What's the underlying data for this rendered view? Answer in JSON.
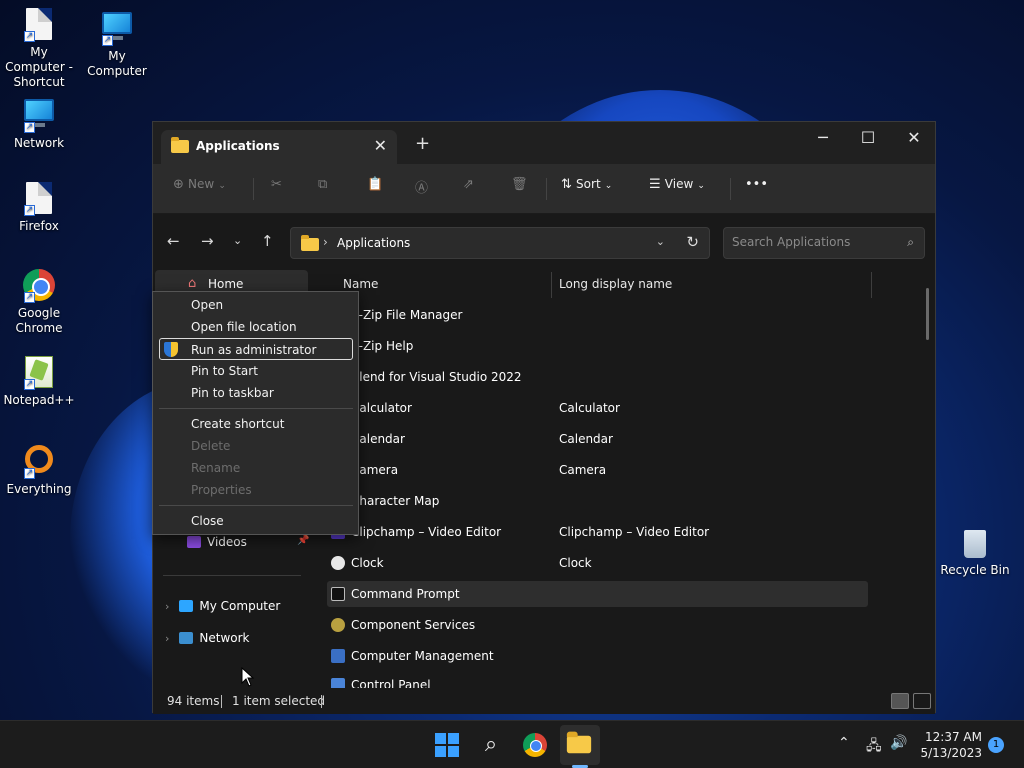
{
  "desktop": {
    "icons": [
      {
        "label": "My Computer - Shortcut"
      },
      {
        "label": "My Computer"
      },
      {
        "label": "Network"
      },
      {
        "label": "Firefox"
      },
      {
        "label": "Google Chrome"
      },
      {
        "label": "Notepad++"
      },
      {
        "label": "Everything"
      }
    ],
    "recycle_bin": "Recycle Bin"
  },
  "window": {
    "tab_title": "Applications",
    "toolbar": {
      "new_label": "New",
      "sort_label": "Sort",
      "view_label": "View"
    },
    "address": {
      "path": "Applications",
      "search_placeholder": "Search Applications"
    },
    "nav": {
      "home": "Home",
      "videos": "Videos",
      "my_computer": "My Computer",
      "network": "Network"
    },
    "columns": {
      "name": "Name",
      "long_display_name": "Long display name"
    },
    "rows": [
      {
        "name": "7-Zip File Manager",
        "long": ""
      },
      {
        "name": "7-Zip Help",
        "long": ""
      },
      {
        "name": "Blend for Visual Studio 2022",
        "long": ""
      },
      {
        "name": "Calculator",
        "long": "Calculator"
      },
      {
        "name": "Calendar",
        "long": "Calendar"
      },
      {
        "name": "Camera",
        "long": "Camera"
      },
      {
        "name": "Character Map",
        "long": ""
      },
      {
        "name": "Clipchamp – Video Editor",
        "long": "Clipchamp – Video Editor"
      },
      {
        "name": "Clock",
        "long": "Clock"
      },
      {
        "name": "Command Prompt",
        "long": ""
      },
      {
        "name": "Component Services",
        "long": ""
      },
      {
        "name": "Computer Management",
        "long": ""
      },
      {
        "name": "Control Panel",
        "long": ""
      }
    ],
    "status": {
      "items": "94 items",
      "selected": "1 item selected"
    }
  },
  "context_menu": {
    "items": [
      {
        "label": "Open",
        "enabled": true
      },
      {
        "label": "Open file location",
        "enabled": true
      },
      {
        "label": "Run as administrator",
        "enabled": true
      },
      {
        "label": "Pin to Start",
        "enabled": true
      },
      {
        "label": "Pin to taskbar",
        "enabled": true
      },
      {
        "label": "Create shortcut",
        "enabled": true
      },
      {
        "label": "Delete",
        "enabled": false
      },
      {
        "label": "Rename",
        "enabled": false
      },
      {
        "label": "Properties",
        "enabled": false
      },
      {
        "label": "Close",
        "enabled": true
      }
    ]
  },
  "taskbar": {
    "time": "12:37 AM",
    "date": "5/13/2023",
    "notification_count": "1"
  },
  "colors": {
    "accent": "#3aa0ff",
    "window_bg": "#191919",
    "menu_bg": "#2b2b2b"
  }
}
